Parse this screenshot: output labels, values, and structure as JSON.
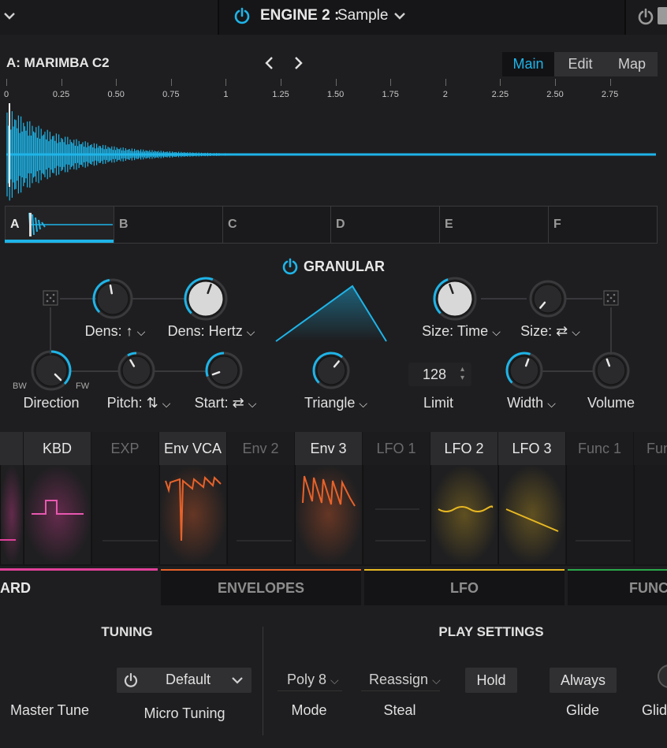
{
  "engine": {
    "title": "ENGINE 2 :",
    "mode": "Sample"
  },
  "sample": {
    "name": "A: MARIMBA C2",
    "view_tabs": [
      "Main",
      "Edit",
      "Map"
    ]
  },
  "ruler": [
    "0",
    "0.25",
    "0.50",
    "0.75",
    "1",
    "1.25",
    "1.50",
    "1.75",
    "2",
    "2.25",
    "2.50",
    "2.75"
  ],
  "slots": [
    "A",
    "B",
    "C",
    "D",
    "E",
    "F"
  ],
  "granular": {
    "title": "GRANULAR",
    "dens_rate_label": "Dens: ↑",
    "dens_hertz_label": "Dens: Hertz",
    "size_time_label": "Size: Time",
    "size_sync_label": "Size: ⇄",
    "bw": "BW",
    "fw": "FW",
    "direction_label": "Direction",
    "pitch_label": "Pitch: ⇅",
    "start_label": "Start: ⇄",
    "shape_label": "Triangle",
    "limit_value": "128",
    "limit_label": "Limit",
    "width_label": "Width",
    "volume_label": "Volume"
  },
  "mod_tabs": [
    "KBD",
    "EXP",
    "Env VCA",
    "Env 2",
    "Env 3",
    "LFO 1",
    "LFO 2",
    "LFO 3",
    "Func 1",
    "Fun"
  ],
  "bottom_tabs": [
    "ARD",
    "ENVELOPES",
    "LFO",
    "FUNCT"
  ],
  "tuning": {
    "title": "TUNING",
    "master_tune_label": "Master Tune",
    "micro_value": "Default",
    "micro_label": "Micro Tuning"
  },
  "play": {
    "title": "PLAY SETTINGS",
    "mode_value": "Poly 8",
    "mode_label": "Mode",
    "steal_value": "Reassign",
    "steal_label": "Steal",
    "hold_label": "Hold",
    "glide_value": "Always",
    "glide_label": "Glide",
    "glide2_label": "Glid"
  },
  "colors": {
    "accent": "#1eb4e8",
    "kbd": "#e0409a",
    "env": "#e8622a",
    "lfo": "#e8b822",
    "func": "#2aa84a"
  }
}
